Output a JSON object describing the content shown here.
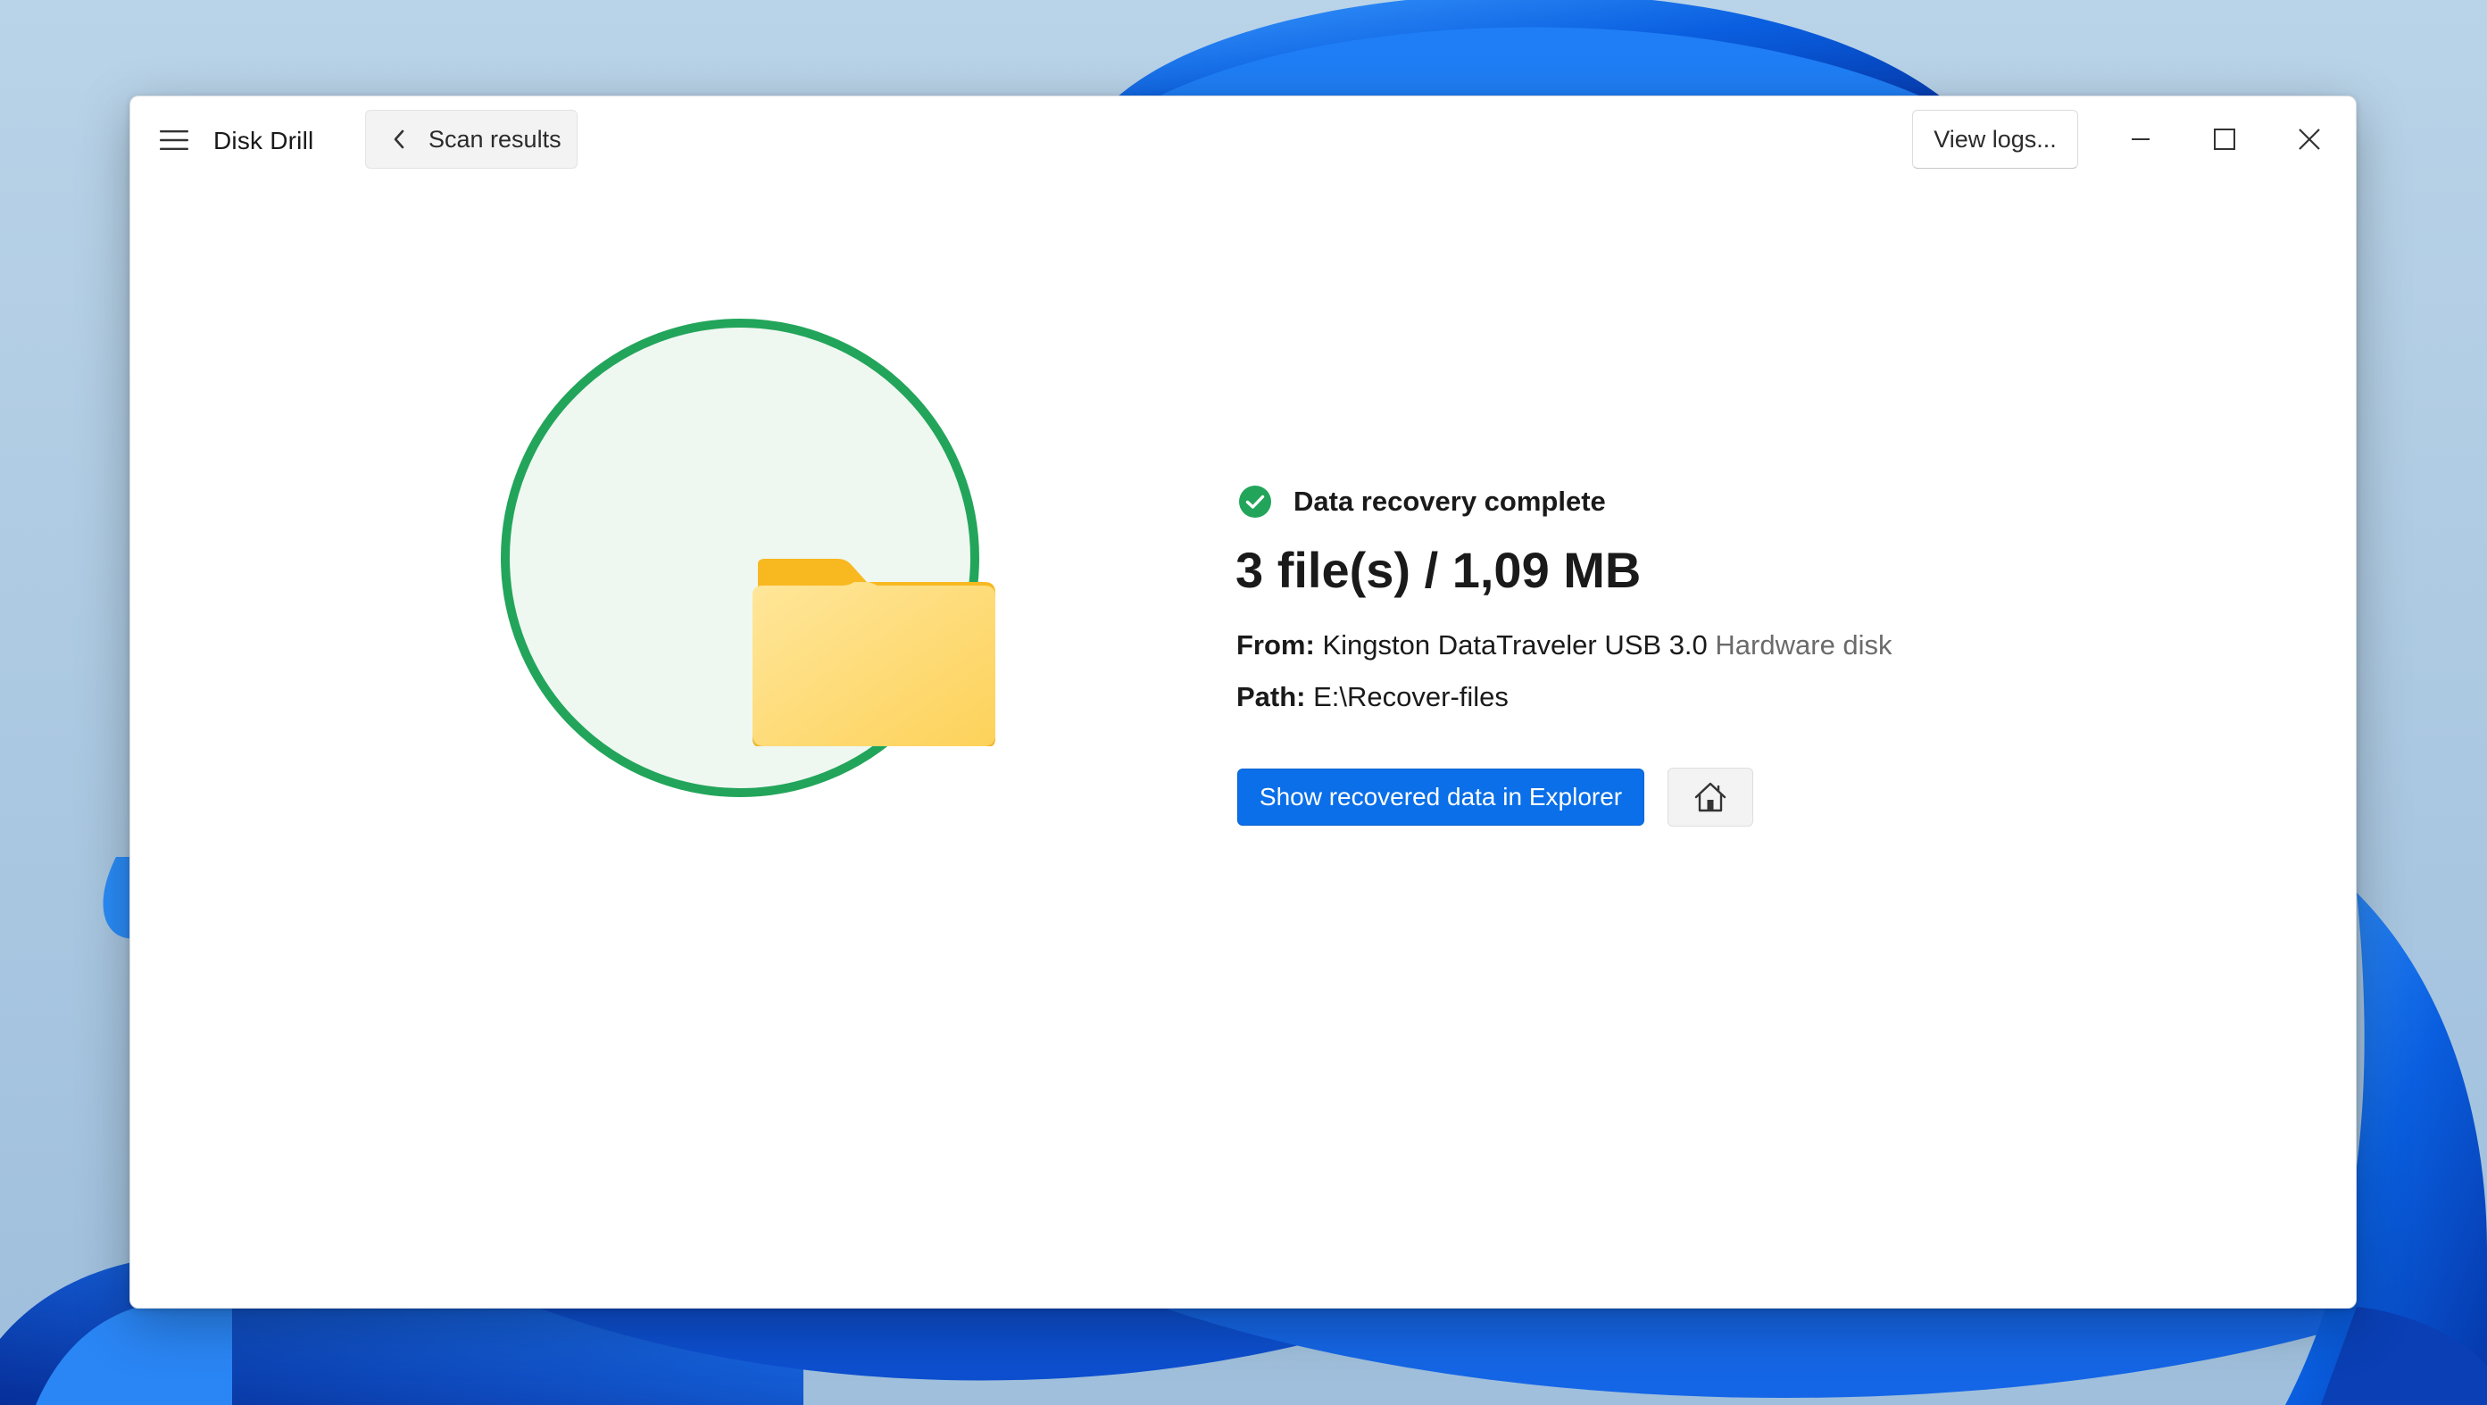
{
  "app": {
    "title": "Disk Drill"
  },
  "toolbar": {
    "back_label": "Scan results",
    "view_logs_label": "View logs..."
  },
  "window_controls": {
    "minimize": "minimize-icon",
    "maximize": "maximize-icon",
    "close": "close-icon"
  },
  "result": {
    "status": "Data recovery complete",
    "summary": "3 file(s) / 1,09 MB",
    "from_key": "From:",
    "from_device": "Kingston DataTraveler USB 3.0",
    "from_type": "Hardware disk",
    "path_key": "Path:",
    "path_value": "E:\\Recover-files"
  },
  "actions": {
    "show_in_explorer_label": "Show recovered data in Explorer",
    "home_icon": "home-icon"
  },
  "icons": {
    "menu": "hamburger-menu-icon",
    "back": "chevron-left-icon",
    "status": "check-circle-icon",
    "hero": "folder-icon"
  },
  "colors": {
    "accent_blue": "#0a6fe8",
    "success_green": "#22a55a",
    "hero_bg": "#eff7f1",
    "folder_yellow": "#fdd667"
  }
}
